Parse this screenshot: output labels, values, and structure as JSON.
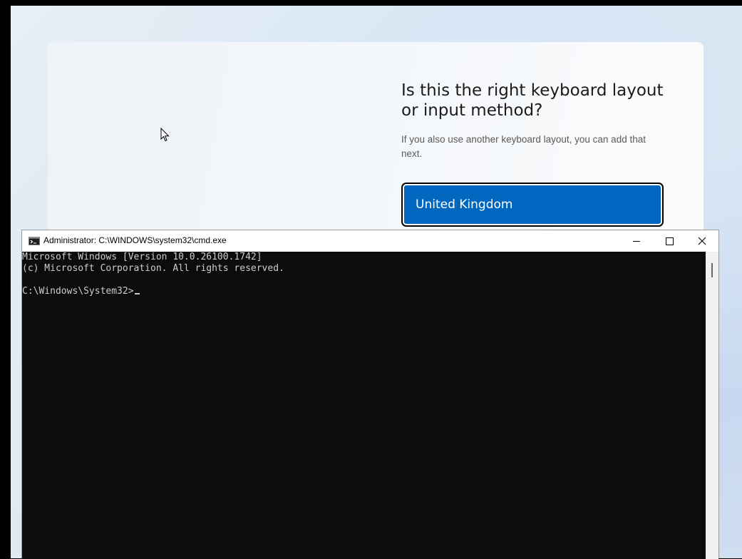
{
  "oobe": {
    "title": "Is this the right keyboard layout or input method?",
    "subtitle": "If you also use another keyboard layout, you can add that next.",
    "selected_layout": "United Kingdom"
  },
  "cmd": {
    "window_title": "Administrator: C:\\WINDOWS\\system32\\cmd.exe",
    "lines": [
      "Microsoft Windows [Version 10.0.26100.1742]",
      "(c) Microsoft Corporation. All rights reserved.",
      "",
      "C:\\Windows\\System32>"
    ]
  },
  "icons": {
    "app": "cmd-icon",
    "minimize": "minimize-icon",
    "maximize": "maximize-icon",
    "close": "close-icon",
    "cursor": "mouse-pointer-icon"
  },
  "colors": {
    "accent": "#0067c0",
    "console_bg": "#0c0c0c",
    "console_fg": "#cccccc"
  }
}
